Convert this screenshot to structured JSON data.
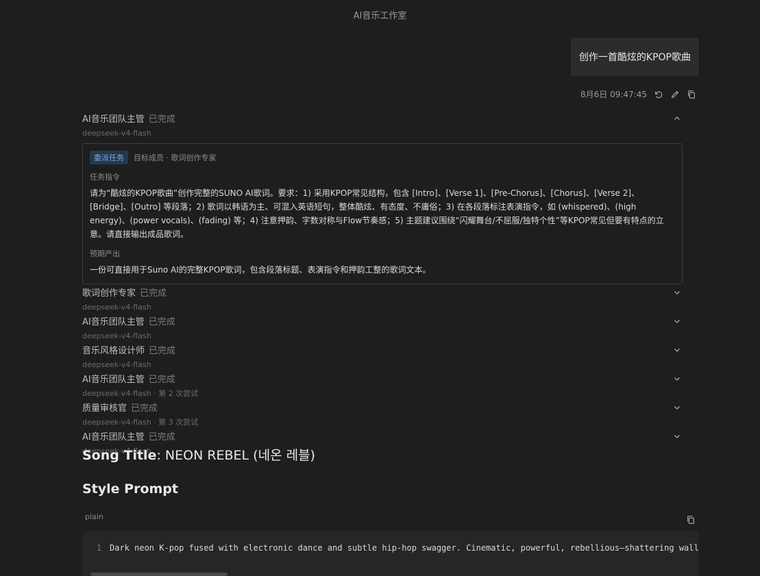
{
  "header": {
    "title": "AI音乐工作室"
  },
  "user_message": {
    "text": "创作一首酷炫的KPOP歌曲"
  },
  "message_meta": {
    "timestamp": "8月6日 09:47:45"
  },
  "agents": [
    {
      "name": "AI音乐团队主管",
      "status": "已完成",
      "model": "deepseek-v4-flash",
      "expanded": true
    },
    {
      "name": "歌词创作专家",
      "status": "已完成",
      "model": "deepseek-v4-flash"
    },
    {
      "name": "AI音乐团队主管",
      "status": "已完成",
      "model": "deepseek-v4-flash"
    },
    {
      "name": "音乐风格设计师",
      "status": "已完成",
      "model": "deepseek-v4-flash"
    },
    {
      "name": "AI音乐团队主管",
      "status": "已完成",
      "model": "deepseek-v4-flash · 第 2 次尝试"
    },
    {
      "name": "质量审核官",
      "status": "已完成",
      "model": "deepseek-v4-flash · 第 3 次尝试"
    },
    {
      "name": "AI音乐团队主管",
      "status": "已完成",
      "model": "deepseek-v4-flash"
    }
  ],
  "task_card": {
    "tag": "委派任务",
    "target": "目标成员 · 歌词创作专家",
    "instruction_label": "任务指令",
    "instruction": "请为“酷炫的KPOP歌曲”创作完整的SUNO AI歌词。要求：1) 采用KPOP常见结构，包含 [Intro]、[Verse 1]、[Pre-Chorus]、[Chorus]、[Verse 2]、[Bridge]、[Outro] 等段落；2) 歌词以韩语为主、可混入英语短句，整体酷炫、有态度、不庸俗；3) 在各段落标注表演指令，如 (whispered)、(high energy)、(power vocals)、(fading) 等；4) 注意押韵、字数对称与Flow节奏感；5) 主题建议围绕“闪耀舞台/不屈服/独特个性”等KPOP常见但要有特点的立意。请直接输出成品歌词。",
    "output_label": "预期产出",
    "output": "一份可直接用于Suno AI的完整KPOP歌词，包含段落标题、表演指令和押韵工整的歌词文本。"
  },
  "song": {
    "title_label": "Song Title",
    "title_sep": ":",
    "title_value": "NEON REBEL (네온 레블)",
    "style_heading": "Style Prompt"
  },
  "code": {
    "lang": "plain",
    "line_number": "1",
    "line_text": "Dark neon K-pop fused with electronic dance and subtle hip-hop swagger. Cinematic, powerful, rebellious—shattering walls"
  }
}
